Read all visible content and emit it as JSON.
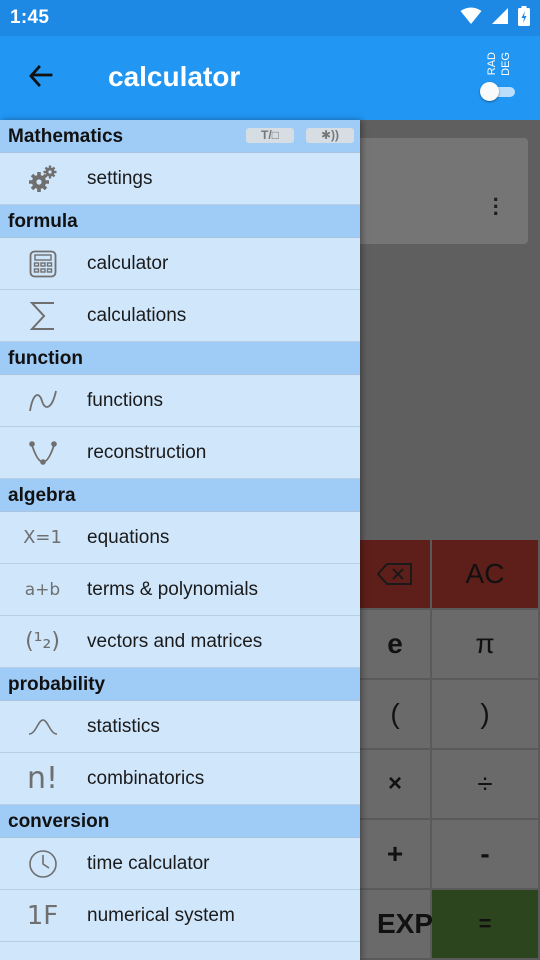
{
  "status": {
    "time": "1:45"
  },
  "app_bar": {
    "title": "calculator",
    "unit_rad": "RAD",
    "unit_deg": "DEG"
  },
  "drawer": {
    "badges": [
      "T/□",
      "✱))"
    ],
    "sections": [
      {
        "title": "Mathematics",
        "items": [
          {
            "label": "settings",
            "icon": "gears-icon"
          }
        ]
      },
      {
        "title": "formula",
        "items": [
          {
            "label": "calculator",
            "icon": "calculator-icon"
          },
          {
            "label": "calculations",
            "icon": "sigma-icon"
          }
        ]
      },
      {
        "title": "function",
        "items": [
          {
            "label": "functions",
            "icon": "function-curve-icon"
          },
          {
            "label": "reconstruction",
            "icon": "parabola-points-icon"
          }
        ]
      },
      {
        "title": "algebra",
        "items": [
          {
            "label": "equations",
            "icon": "equation-icon",
            "icon_text": "X=1"
          },
          {
            "label": "terms & polynomials",
            "icon": "terms-icon",
            "icon_text": "a+b"
          },
          {
            "label": "vectors and matrices",
            "icon": "vector-icon",
            "icon_text": "(¹₂)"
          }
        ]
      },
      {
        "title": "probability",
        "items": [
          {
            "label": "statistics",
            "icon": "bell-curve-icon"
          },
          {
            "label": "combinatorics",
            "icon": "factorial-icon",
            "icon_text": "n!"
          }
        ]
      },
      {
        "title": "conversion",
        "items": [
          {
            "label": "time calculator",
            "icon": "clock-icon"
          },
          {
            "label": "numerical system",
            "icon": "hex-icon",
            "icon_text": "1F"
          }
        ]
      }
    ]
  },
  "keypad": {
    "keys": [
      "⌫",
      "AC",
      "e",
      "π",
      "(",
      ")",
      "×",
      "÷",
      "+",
      "-",
      "EXP",
      "="
    ]
  }
}
